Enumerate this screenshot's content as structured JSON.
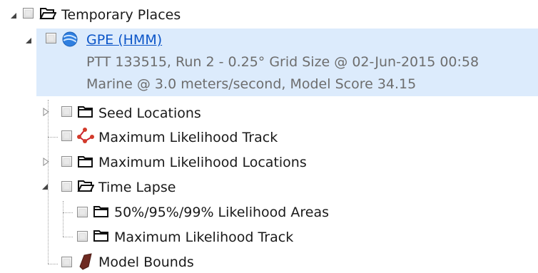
{
  "tree": {
    "root": {
      "label": "Temporary Places",
      "icon": "folder-open-icon"
    },
    "gpe": {
      "title": "GPE (HMM)",
      "detail_line1": "PTT 133515, Run 2 - 0.25° Grid Size @ 02-Jun-2015 00:58",
      "detail_line2": "Marine @ 3.0 meters/second, Model Score 34.15",
      "icon": "globe-icon"
    },
    "items": [
      {
        "label": "Seed Locations",
        "icon": "folder-icon"
      },
      {
        "label": "Maximum Likelihood Track",
        "icon": "track-icon"
      },
      {
        "label": "Maximum Likelihood Locations",
        "icon": "folder-icon"
      },
      {
        "label": "Time Lapse",
        "icon": "folder-open-icon"
      },
      {
        "label": "50%/95%/99% Likelihood Areas",
        "icon": "folder-icon"
      },
      {
        "label": "Maximum Likelihood Track",
        "icon": "folder-icon"
      },
      {
        "label": "Model Bounds",
        "icon": "polygon-icon"
      }
    ]
  }
}
